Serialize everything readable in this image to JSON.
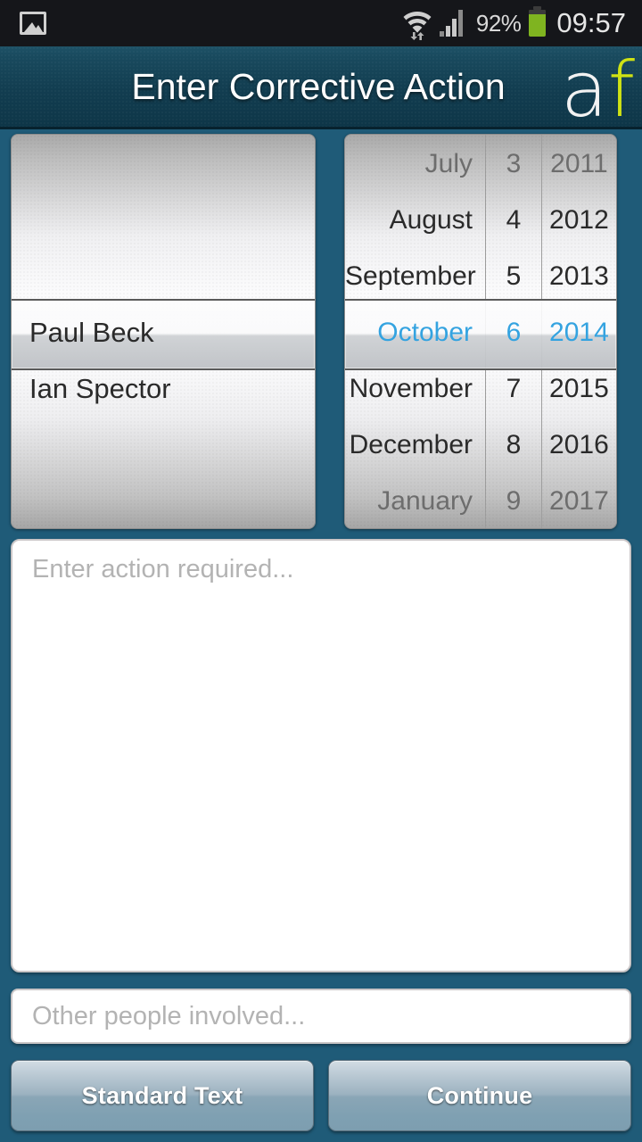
{
  "statusbar": {
    "notification_icon": "gallery-icon",
    "wifi_icon": "wifi-icon",
    "signal_icon": "signal-bars-icon",
    "battery_percent": "92%",
    "battery_icon": "battery-icon",
    "clock": "09:57"
  },
  "header": {
    "title": "Enter Corrective Action",
    "logo_a": "a",
    "logo_f": "f",
    "logo_color_a": "#f2f2f2",
    "logo_color_f": "#cfe214",
    "background_color": "#123d50"
  },
  "theme": {
    "page_background": "#1f5b78",
    "selected_text_color": "#34a3e0",
    "status_battery_color": "#7fb420"
  },
  "person_picker": {
    "items": [
      "",
      "",
      "",
      "Paul Beck",
      "Ian Spector",
      "",
      ""
    ],
    "selected_index": 3,
    "selected_value": "Paul Beck"
  },
  "date_picker": {
    "months": [
      "July",
      "August",
      "September",
      "October",
      "November",
      "December",
      "January"
    ],
    "days": [
      "3",
      "4",
      "5",
      "6",
      "7",
      "8",
      "9"
    ],
    "years": [
      "2011",
      "2012",
      "2013",
      "2014",
      "2015",
      "2016",
      "2017"
    ],
    "selected_index": 3,
    "selected_month": "October",
    "selected_day": "6",
    "selected_year": "2014"
  },
  "action_textarea": {
    "placeholder": "Enter action required...",
    "value": ""
  },
  "people_input": {
    "placeholder": "Other people involved...",
    "value": ""
  },
  "buttons": {
    "standard_text": "Standard Text",
    "continue": "Continue"
  }
}
